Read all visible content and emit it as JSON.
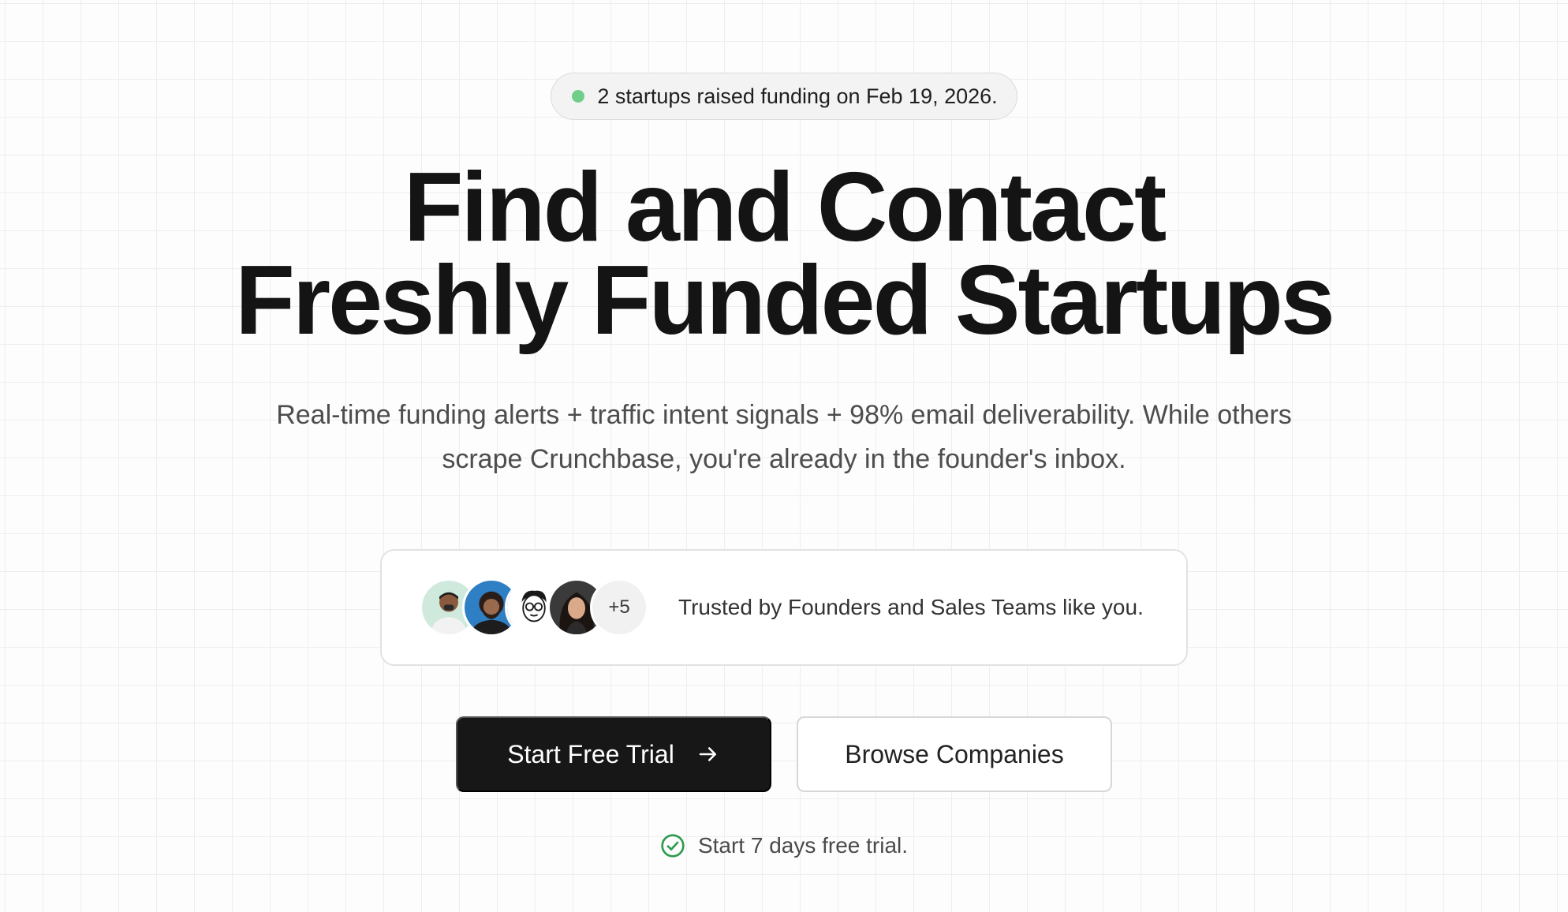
{
  "announcement": {
    "text": "2 startups raised funding on Feb 19, 2026.",
    "status_color": "#6fce8a"
  },
  "hero": {
    "title_line1": "Find and Contact",
    "title_line2": "Freshly Funded Startups",
    "subtitle": "Real-time funding alerts + traffic intent signals + 98% email deliverability. While others scrape Crunchbase, you're already in the founder's inbox."
  },
  "social_proof": {
    "avatars": [
      "avatar-founder-1",
      "avatar-founder-2",
      "avatar-cartoon",
      "avatar-founder-3"
    ],
    "more_count": "+5",
    "text": "Trusted by Founders and Sales Teams like you."
  },
  "cta": {
    "primary_label": "Start Free Trial",
    "primary_icon": "arrow-right-icon",
    "secondary_label": "Browse Companies"
  },
  "trial_note": {
    "icon": "check-circle-icon",
    "text": "Start 7 days free trial.",
    "icon_color": "#2e9b4f"
  }
}
